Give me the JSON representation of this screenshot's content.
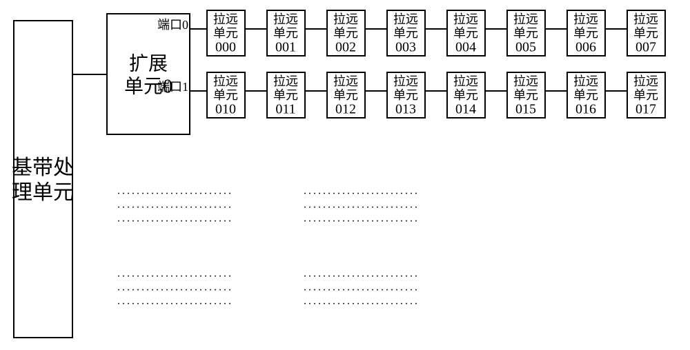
{
  "baseband": {
    "label_line1": "基带处",
    "label_line2": "理单元"
  },
  "extension": {
    "label_line1": "扩展",
    "label_line2": "单元0",
    "ports": [
      {
        "label": "端口0"
      },
      {
        "label": "端口1"
      }
    ]
  },
  "remote_unit_label_line1": "拉远",
  "remote_unit_label_line2": "单元",
  "rows": [
    {
      "ids": [
        "000",
        "001",
        "002",
        "003",
        "004",
        "005",
        "006",
        "007"
      ]
    },
    {
      "ids": [
        "010",
        "011",
        "012",
        "013",
        "014",
        "015",
        "016",
        "017"
      ]
    }
  ],
  "ellipsis": "........................"
}
